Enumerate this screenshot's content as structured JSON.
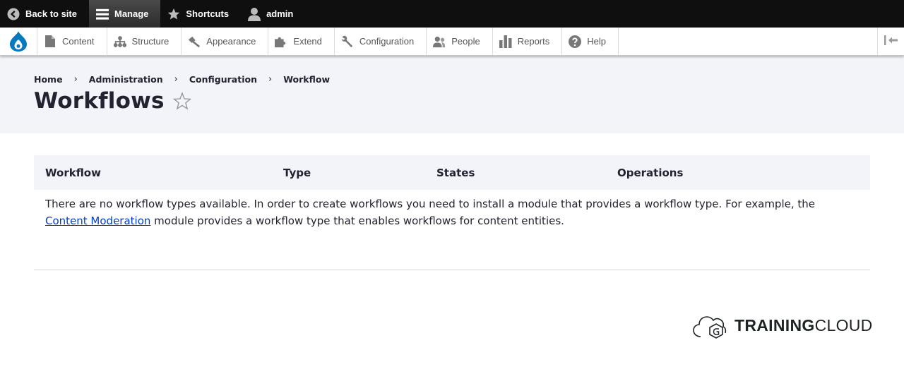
{
  "toolbar": {
    "back_label": "Back to site",
    "manage_label": "Manage",
    "shortcuts_label": "Shortcuts",
    "user_label": "admin"
  },
  "tray": {
    "items": [
      {
        "label": "Content",
        "icon": "file-icon"
      },
      {
        "label": "Structure",
        "icon": "sitemap-icon"
      },
      {
        "label": "Appearance",
        "icon": "paintbrush-icon"
      },
      {
        "label": "Extend",
        "icon": "puzzle-icon"
      },
      {
        "label": "Configuration",
        "icon": "wrench-icon"
      },
      {
        "label": "People",
        "icon": "people-icon"
      },
      {
        "label": "Reports",
        "icon": "bar-chart-icon"
      },
      {
        "label": "Help",
        "icon": "help-icon"
      }
    ]
  },
  "breadcrumb": [
    "Home",
    "Administration",
    "Configuration",
    "Workflow"
  ],
  "page": {
    "title": "Workflows"
  },
  "table": {
    "headers": [
      "Workflow",
      "Type",
      "States",
      "Operations"
    ],
    "empty_text_before": "There are no workflow types available. In order to create workflows you need to install a module that provides a workflow type. For example, the ",
    "empty_link": "Content Moderation",
    "empty_text_after": " module provides a workflow type that enables workflows for content entities."
  },
  "brand": {
    "bold": "TRAINING",
    "light": "CLOUD"
  },
  "colors": {
    "toolbar_bg": "#0f0f0f",
    "header_bg": "#f3f4f9",
    "link": "#003ecc",
    "drupal_blue": "#0678be"
  }
}
